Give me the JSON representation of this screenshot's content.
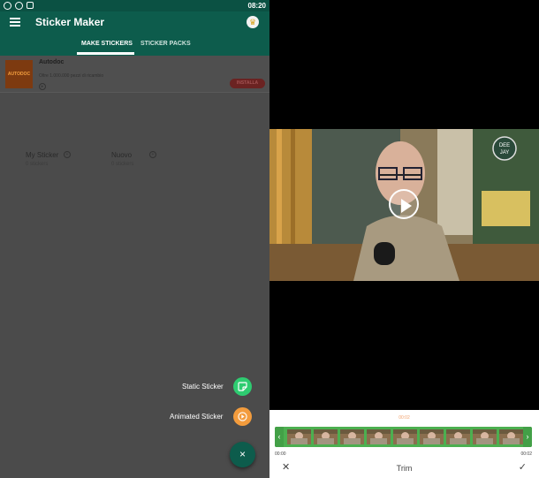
{
  "status_bar": {
    "time": "08:20"
  },
  "app": {
    "title": "Sticker Maker"
  },
  "tabs": [
    {
      "label": "MAKE STICKERS",
      "active": true
    },
    {
      "label": "STICKER PACKS",
      "active": false
    }
  ],
  "ad": {
    "logo_text": "AUTODOC",
    "title": "Autodoc",
    "description": "Oltre 1.000.000 pezzi di ricambio",
    "install_label": "INSTALLA"
  },
  "packs": [
    {
      "name": "My Sticker",
      "count": "0 stickers"
    },
    {
      "name": "Nuovo",
      "count": "0 stickers"
    }
  ],
  "fab_options": [
    {
      "label": "Static Sticker",
      "color": "#2ecc71",
      "icon": "sticker-icon"
    },
    {
      "label": "Animated Sticker",
      "color": "#f39c3d",
      "icon": "play-circle-icon"
    }
  ],
  "fab_main": {
    "label": "×",
    "color": "#0d5c4c"
  },
  "video_overlay": {
    "logo_text": "DEE JAY"
  },
  "trim": {
    "selected_duration": "00:02",
    "start_time": "00:00",
    "end_time": "00:02",
    "title": "Trim"
  },
  "colors": {
    "primary": "#0d5c4c",
    "accent_green": "#4caf50",
    "overlay": "#4b4b4b"
  }
}
